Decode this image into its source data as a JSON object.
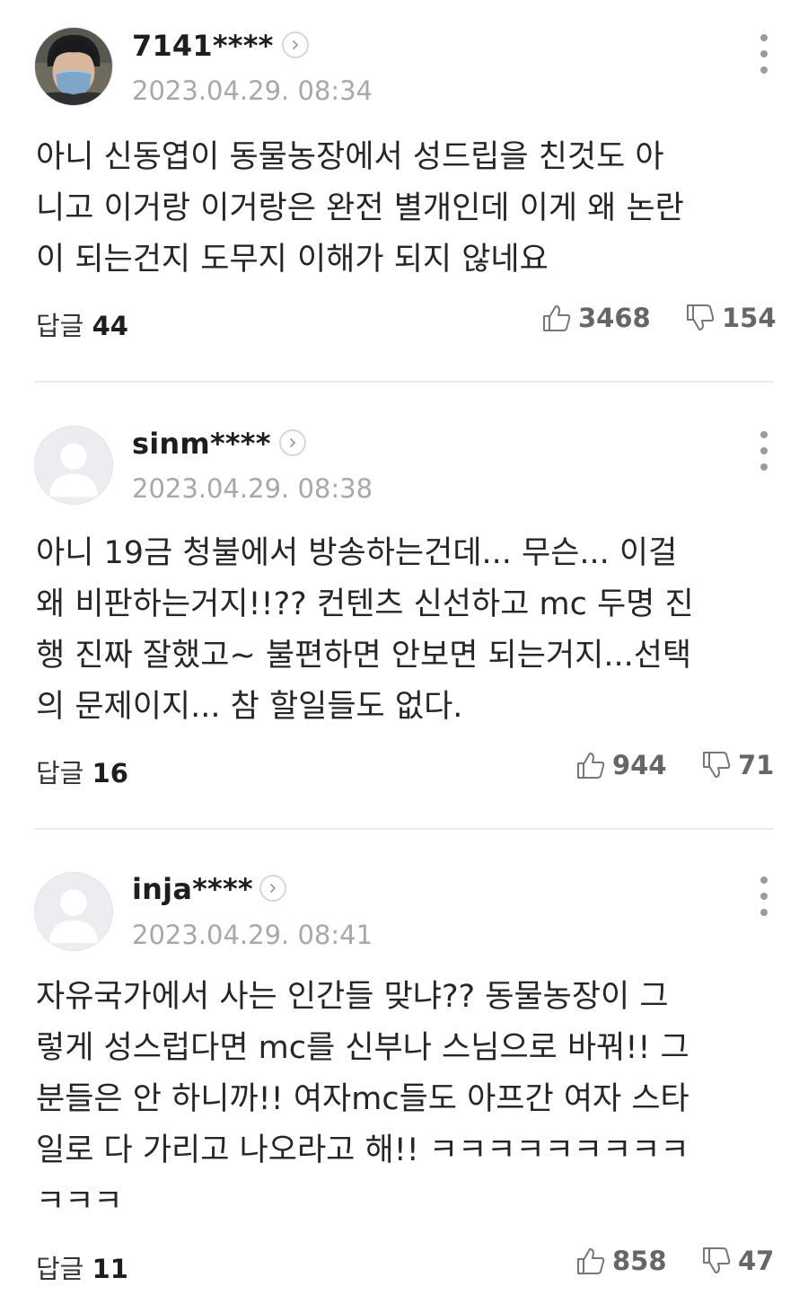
{
  "comments": [
    {
      "username": "7141****",
      "date": "2023.04.29. 08:34",
      "avatar": "profile-photo",
      "body": "아니 신동엽이 동물농장에서 성드립을 친것도 아\n니고 이거랑 이거랑은 완전 별개인데 이게 왜 논란\n이 되는건지 도무지 이해가 되지 않네요",
      "reply_label": "답글",
      "reply_count": "44",
      "likes": "3468",
      "dislikes": "154"
    },
    {
      "username": "sinm****",
      "date": "2023.04.29. 08:38",
      "avatar": "default-avatar",
      "body": "아니 19금 청불에서 방송하는건데... 무슨... 이걸\n왜 비판하는거지!!?? 컨텐츠 신선하고 mc 두명 진\n행 진짜 잘했고~ 불편하면 안보면 되는거지...선택\n의 문제이지... 참 할일들도 없다.",
      "reply_label": "답글",
      "reply_count": "16",
      "likes": "944",
      "dislikes": "71"
    },
    {
      "username": "inja****",
      "date": "2023.04.29. 08:41",
      "avatar": "default-avatar",
      "body": "자유국가에서 사는 인간들 맞냐?? 동물농장이 그\n렇게 성스럽다면 mc를 신부나 스님으로 바꿔!! 그\n분들은 안 하니까!! 여자mc들도 아프간 여자 스타\n일로 다 가리고 나오라고 해!! ㅋㅋㅋㅋㅋㅋㅋㅋㅋ\nㅋㅋㅋ",
      "reply_label": "답글",
      "reply_count": "11",
      "likes": "858",
      "dislikes": "47"
    }
  ],
  "colors": {
    "date": "#a8a8a8",
    "divider": "#ececec",
    "vote": "#666666"
  }
}
